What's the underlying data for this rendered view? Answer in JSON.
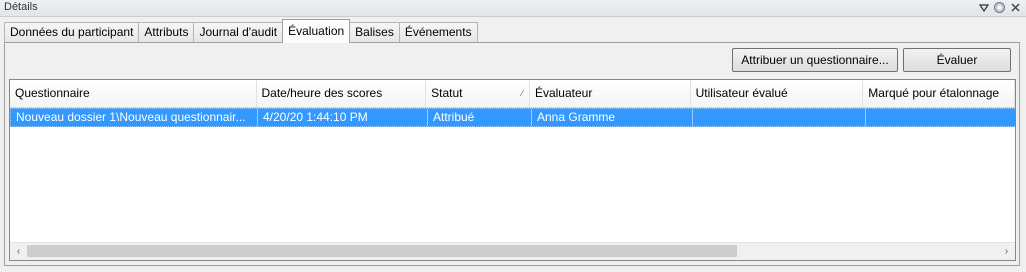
{
  "window": {
    "title": "Détails"
  },
  "tabs": [
    {
      "label": "Données du participant"
    },
    {
      "label": "Attributs"
    },
    {
      "label": "Journal d'audit"
    },
    {
      "label": "Évaluation",
      "active": true
    },
    {
      "label": "Balises"
    },
    {
      "label": "Événements"
    }
  ],
  "toolbar": {
    "assign_label": "Attribuer un questionnaire...",
    "evaluate_label": "Évaluer"
  },
  "table": {
    "columns": [
      {
        "label": "Questionnaire"
      },
      {
        "label": "Date/heure des scores"
      },
      {
        "label": "Statut"
      },
      {
        "label": "Évaluateur"
      },
      {
        "label": "Utilisateur évalué"
      },
      {
        "label": "Marqué pour étalonnage"
      }
    ],
    "rows": [
      {
        "questionnaire": "Nouveau dossier 1\\Nouveau questionnair...",
        "date": "4/20/20 1:44:10 PM",
        "statut": "Attribué",
        "evaluateur": "Anna Gramme",
        "utilisateur": "",
        "etalonnage": ""
      }
    ]
  },
  "icons": {
    "title_dropdown": "dropdown-triangle-icon",
    "title_pin": "pin-icon",
    "title_close": "close-icon"
  },
  "colors": {
    "selection": "#3399ff",
    "selection_text": "#ffffff"
  }
}
